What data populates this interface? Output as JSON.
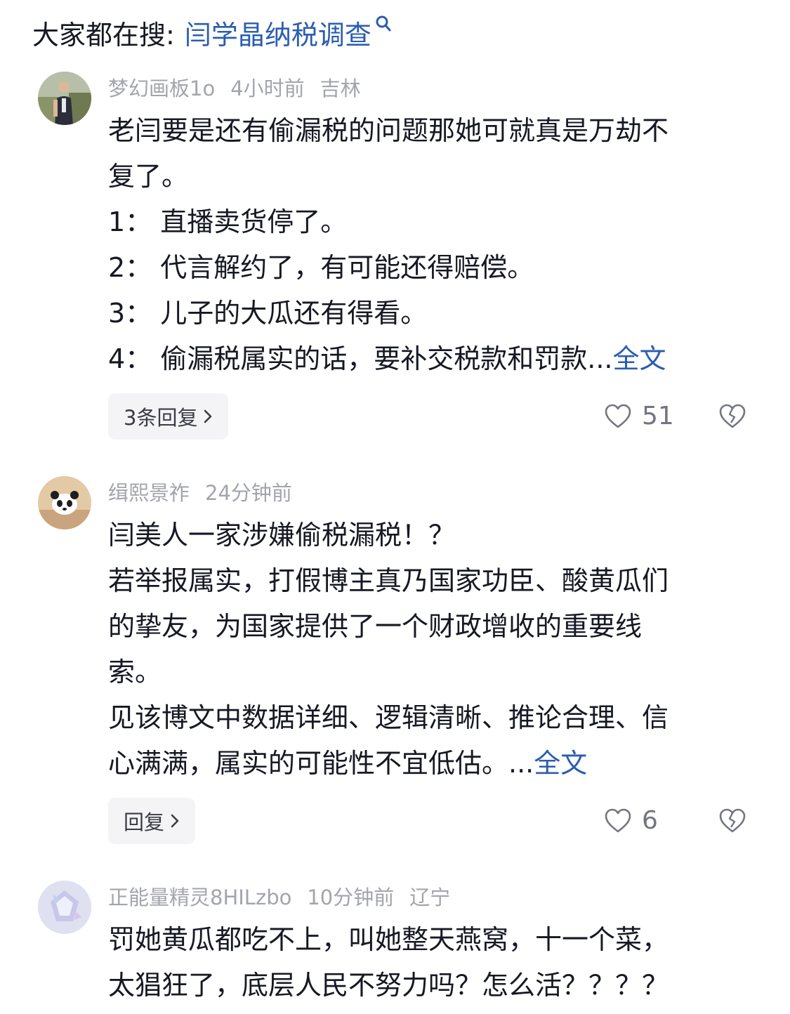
{
  "search": {
    "prefix": "大家都在搜:",
    "term": "闫学晶纳税调查"
  },
  "comments": [
    {
      "username": "梦幻画板1o",
      "time": "4小时前",
      "location": "吉林",
      "lines": [
        "老闫要是还有偷漏税的问题那她可就真是万劫不",
        "复了。",
        "1：  直播卖货停了。",
        "2：  代言解约了，有可能还得赔偿。",
        "3：  儿子的大瓜还有得看。",
        "4：  偷漏税属实的话，要补交税款和罚款..."
      ],
      "more_label": "全文",
      "reply_label": "3条回复",
      "like_count": "51"
    },
    {
      "username": "缉熙景祚",
      "time": "24分钟前",
      "lines": [
        "闫美人一家涉嫌偷税漏税！？",
        "若举报属实，打假博主真乃国家功臣、酸黄瓜们",
        "的挚友，为国家提供了一个财政增收的重要线",
        "索。",
        "见该博文中数据详细、逻辑清晰、推论合理、信",
        "心满满，属实的可能性不宜低估。..."
      ],
      "more_label": "全文",
      "reply_label": "回复",
      "like_count": "6"
    },
    {
      "username": "正能量精灵8HILzbo",
      "time": "10分钟前",
      "location": "辽宁",
      "lines": [
        "罚她黄瓜都吃不上，叫她整天燕窝，十一个菜，",
        "太猖狂了，底层人民不努力吗？怎么活？？？？"
      ]
    }
  ],
  "colors": {
    "link": "#2a5db0",
    "meta": "#a3a5ac",
    "text": "#161823"
  }
}
